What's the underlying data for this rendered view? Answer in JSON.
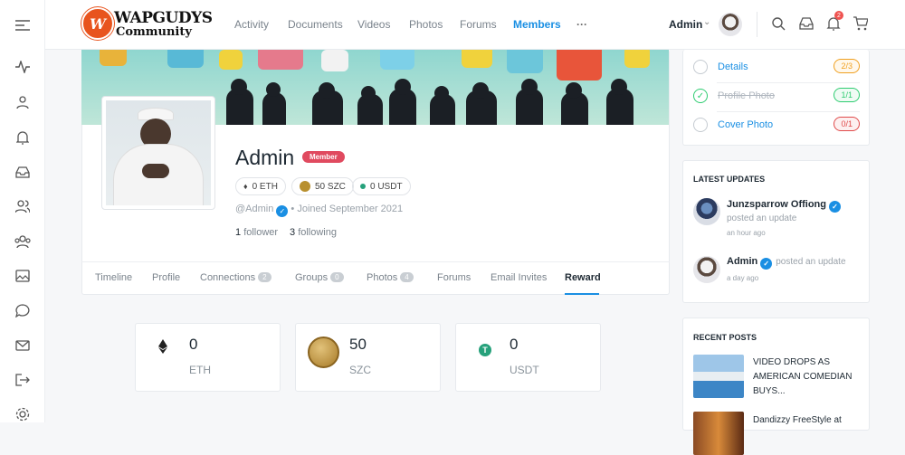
{
  "brand": {
    "line1": "WAPGUDYS",
    "line2": "Community",
    "mark": "W"
  },
  "nav": {
    "items": [
      "Activity",
      "Documents",
      "Videos",
      "Photos",
      "Forums",
      "Members"
    ],
    "active": "Members",
    "more": "···"
  },
  "user": {
    "name": "Admin",
    "notifications": "2"
  },
  "profile": {
    "name": "Admin",
    "badge": "Member",
    "handle": "@Admin",
    "joined": "• Joined September 2021",
    "followers_count": "1",
    "followers_label": "follower",
    "following_count": "3",
    "following_label": "following",
    "coins": [
      {
        "label": "0 ETH"
      },
      {
        "label": "50 SZC"
      },
      {
        "label": "0 USDT"
      }
    ]
  },
  "tabs": [
    {
      "label": "Timeline"
    },
    {
      "label": "Profile"
    },
    {
      "label": "Connections",
      "count": "2"
    },
    {
      "label": "Groups",
      "count": "0"
    },
    {
      "label": "Photos",
      "count": "4"
    },
    {
      "label": "Forums"
    },
    {
      "label": "Email Invites"
    },
    {
      "label": "Reward"
    }
  ],
  "rewards": [
    {
      "value": "0",
      "label": "ETH"
    },
    {
      "value": "50",
      "label": "SZC"
    },
    {
      "value": "0",
      "label": "USDT"
    }
  ],
  "checklist": [
    {
      "label": "Details",
      "progress": "2/3",
      "done": false,
      "color": "#f0a020"
    },
    {
      "label": "Profile Photo",
      "progress": "1/1",
      "done": true,
      "color": "#2ecc71"
    },
    {
      "label": "Cover Photo",
      "progress": "0/1",
      "done": false,
      "color": "#e04a4a"
    }
  ],
  "latest_updates": {
    "title": "LATEST UPDATES",
    "items": [
      {
        "name": "Junzsparrow Offiong",
        "action": "posted an update",
        "time": "an hour ago"
      },
      {
        "name": "Admin",
        "action": "posted an update",
        "time": "a day ago"
      }
    ]
  },
  "recent_posts": {
    "title": "RECENT POSTS",
    "items": [
      {
        "title": "VIDEO DROPS AS AMERICAN COMEDIAN BUYS..."
      },
      {
        "title": "Dandizzy FreeStyle at"
      }
    ]
  },
  "icons": {
    "sidebar": [
      "menu-icon",
      "activity-icon",
      "user-icon",
      "bell-icon",
      "inbox-icon",
      "friends-icon",
      "groups-icon",
      "photo-icon",
      "forum-icon",
      "mail-icon",
      "logout-icon",
      "settings-icon"
    ],
    "top": [
      "search-icon",
      "inbox-icon",
      "bell-icon",
      "cart-icon"
    ]
  },
  "colors": {
    "accent": "#1a8fe3",
    "badge": "#e04a5f",
    "usdt": "#26a17b"
  }
}
